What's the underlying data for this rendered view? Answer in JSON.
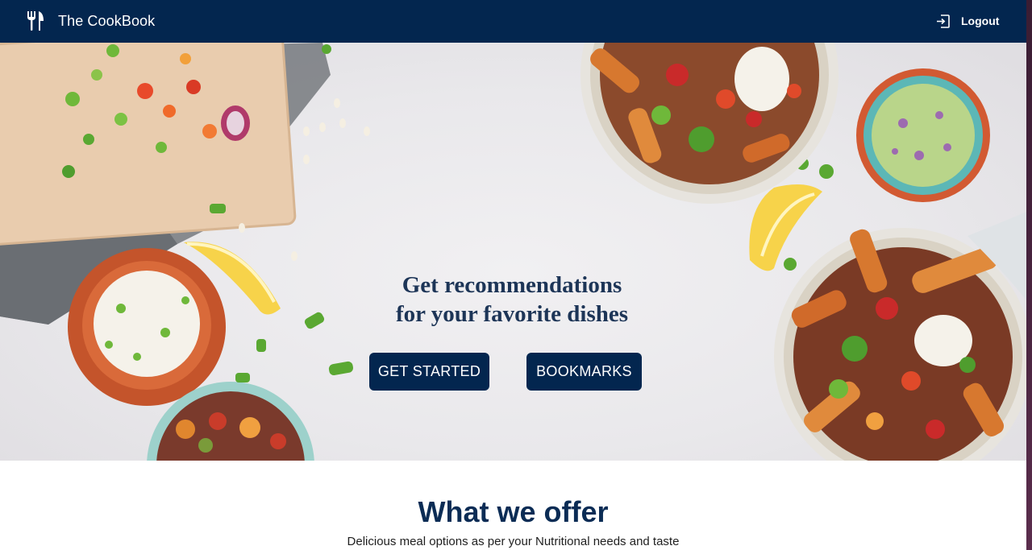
{
  "navbar": {
    "brand": "The CookBook",
    "brand_icon": "fork-knife-icon",
    "logout_label": "Logout",
    "logout_icon": "logout-icon"
  },
  "hero": {
    "headline_line1": "Get recommendations",
    "headline_line2": "for your favorite dishes",
    "get_started_label": "GET STARTED",
    "bookmarks_label": "BOOKMARKS"
  },
  "offer": {
    "title": "What we offer",
    "subtitle": "Delicious meal options as per your Nutritional needs and taste"
  },
  "colors": {
    "navbar": "#03264f",
    "button": "#03264f",
    "heading": "#0b2c55",
    "hero_background": "#ebeaed"
  }
}
